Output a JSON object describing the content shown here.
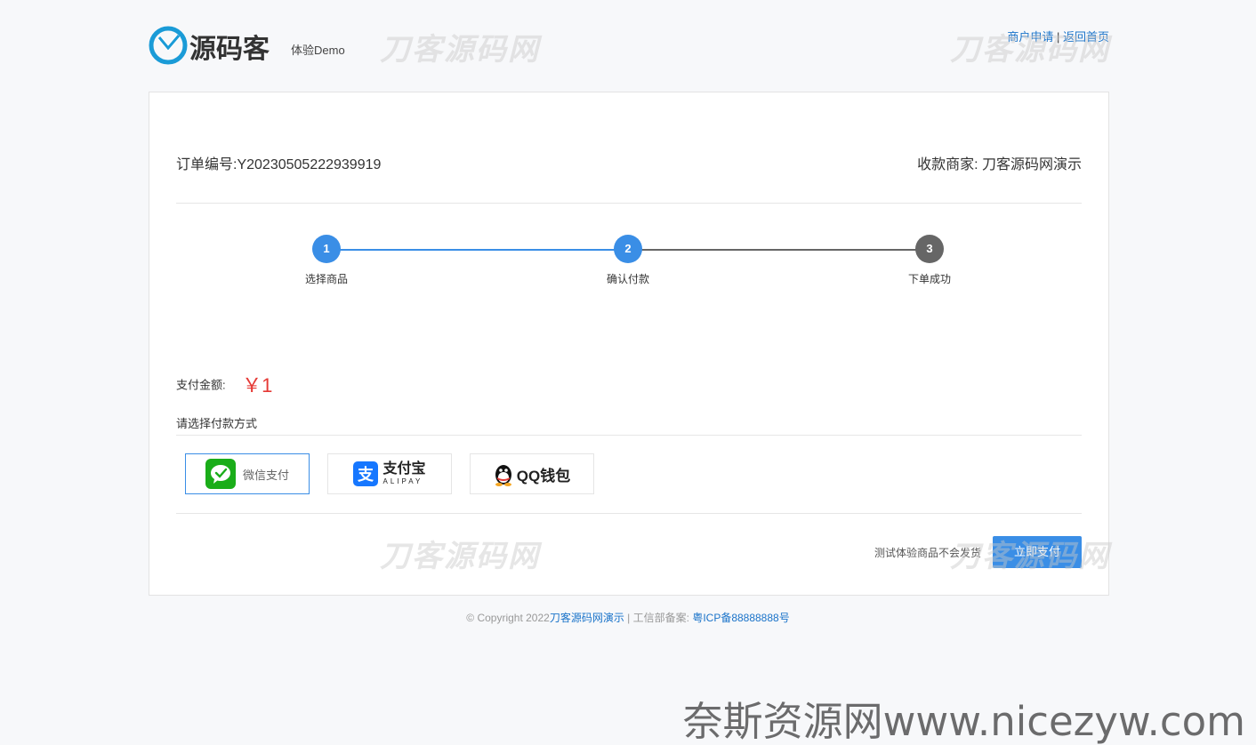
{
  "header": {
    "logo_text": "源码客",
    "logo_sub": "体验Demo",
    "link_merchant": "商户申请",
    "link_separator": "|",
    "link_home": "返回首页"
  },
  "watermarks": {
    "site_mark": "刀客源码网",
    "bottom_banner": "奈斯资源网www.nicezyw.com"
  },
  "order": {
    "number_label": "订单编号:",
    "number": "Y20230505222939919",
    "merchant_label": "收款商家:",
    "merchant": "刀客源码网演示"
  },
  "steps": [
    {
      "num": "1",
      "label": "选择商品",
      "state": "done"
    },
    {
      "num": "2",
      "label": "确认付款",
      "state": "active"
    },
    {
      "num": "3",
      "label": "下单成功",
      "state": "pending"
    }
  ],
  "colors": {
    "accent": "#3a8ee6",
    "step_pending": "#666666",
    "amount": "#e53935",
    "wechat": "#1aad19",
    "alipay": "#1677ff"
  },
  "payment": {
    "amount_label": "支付金额:",
    "amount": "￥1",
    "method_title": "请选择付款方式",
    "methods": [
      {
        "name": "微信支付",
        "icon": "wechat-icon",
        "selected": true
      },
      {
        "name": "支付宝",
        "sub": "ALIPAY",
        "icon": "alipay-icon",
        "selected": false
      },
      {
        "name": "QQ钱包",
        "icon": "qq-icon",
        "selected": false
      }
    ],
    "notice": "测试体验商品不会发货",
    "pay_now": "立即支付"
  },
  "footer": {
    "copyright": "© Copyright 2022",
    "site_link": "刀客源码网演示",
    "icp_label": " | 工信部备案: ",
    "icp_link": "粤ICP备88888888号"
  }
}
